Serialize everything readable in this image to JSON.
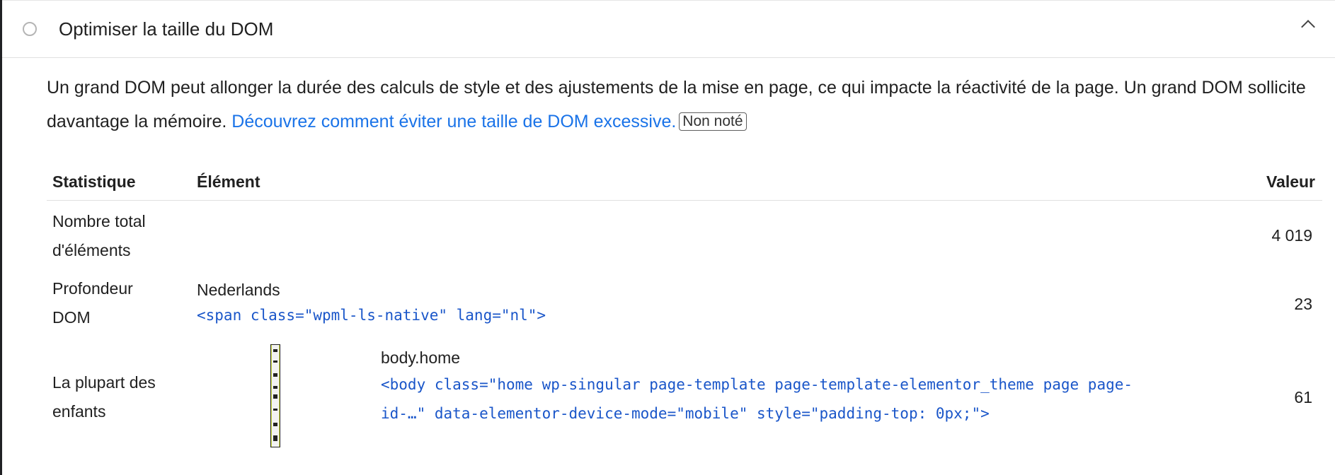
{
  "audit": {
    "title": "Optimiser la taille du DOM",
    "description_text": "Un grand DOM peut allonger la durée des calculs de style et des ajustements de la mise en page, ce qui impacte la réactivité de la page. Un grand DOM sollicite davantage la mémoire. ",
    "learn_more_link": "Découvrez comment éviter une taille de DOM excessive.",
    "badge": "Non noté"
  },
  "table": {
    "headers": {
      "statistic": "Statistique",
      "element": "Élément",
      "value": "Valeur"
    },
    "rows": [
      {
        "statistic_line1": "Nombre total",
        "statistic_line2": "d'éléments",
        "node_label": "",
        "node_snippet": "",
        "value": "4 019"
      },
      {
        "statistic_line1": "Profondeur",
        "statistic_line2": "DOM",
        "node_label": "Nederlands",
        "node_snippet": "<span class=\"wpml-ls-native\" lang=\"nl\">",
        "value": "23"
      },
      {
        "statistic_line1": "La plupart des",
        "statistic_line2": "enfants",
        "node_label": "body.home",
        "node_snippet_line1": "<body class=\"home wp-singular page-template page-template-elementor_theme page page-",
        "node_snippet_line2": "id-…\" data-elementor-device-mode=\"mobile\" style=\"padding-top: 0px;\">",
        "value": "61"
      }
    ]
  },
  "icons": {
    "status": "circle-outline-icon",
    "toggle": "chevron-up-icon"
  },
  "colors": {
    "link": "#1a73e8",
    "code": "#1a56c9",
    "status_icon": "#b5b5b5"
  }
}
